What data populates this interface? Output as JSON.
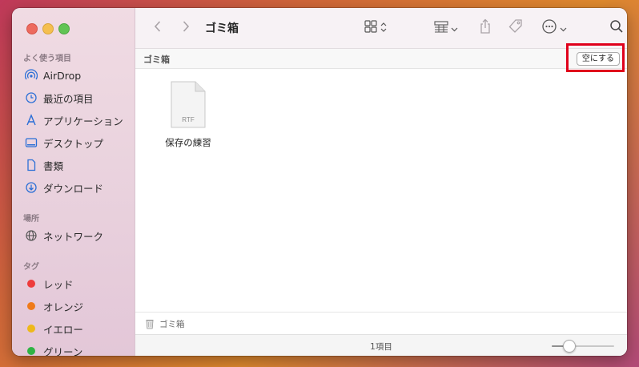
{
  "window": {
    "title": "ゴミ箱"
  },
  "sidebar": {
    "sections": [
      {
        "title": "よく使う項目",
        "items": [
          {
            "label": "AirDrop",
            "icon": "airdrop-icon"
          },
          {
            "label": "最近の項目",
            "icon": "clock-icon"
          },
          {
            "label": "アプリケーション",
            "icon": "applications-icon"
          },
          {
            "label": "デスクトップ",
            "icon": "desktop-icon"
          },
          {
            "label": "書類",
            "icon": "document-icon"
          },
          {
            "label": "ダウンロード",
            "icon": "download-icon"
          }
        ]
      },
      {
        "title": "場所",
        "items": [
          {
            "label": "ネットワーク",
            "icon": "network-icon"
          }
        ]
      },
      {
        "title": "タグ",
        "items": [
          {
            "label": "レッド",
            "color": "#ee3b3b"
          },
          {
            "label": "オレンジ",
            "color": "#ef7a1a"
          },
          {
            "label": "イエロー",
            "color": "#eeb81a"
          },
          {
            "label": "グリーン",
            "color": "#2fb344"
          }
        ]
      }
    ]
  },
  "toolbar": {
    "back_icon": "chevron-left-icon",
    "forward_icon": "chevron-right-icon",
    "view_icon": "grid-view-icon",
    "group_icon": "group-icon",
    "share_icon": "share-icon",
    "tag_icon": "tag-icon",
    "more_icon": "ellipsis-circle-icon",
    "search_icon": "search-icon"
  },
  "pathbar": {
    "label": "ゴミ箱",
    "empty_button": "空にする"
  },
  "files": [
    {
      "name": "保存の練習",
      "type_label": "RTF"
    }
  ],
  "bottom_path": {
    "label": "ゴミ箱",
    "icon": "trash-icon"
  },
  "status": {
    "count": "1項目",
    "zoom_fraction": 0.27
  },
  "colors": {
    "accent": "#2b6fd6",
    "highlight_box": "#e0001b"
  }
}
